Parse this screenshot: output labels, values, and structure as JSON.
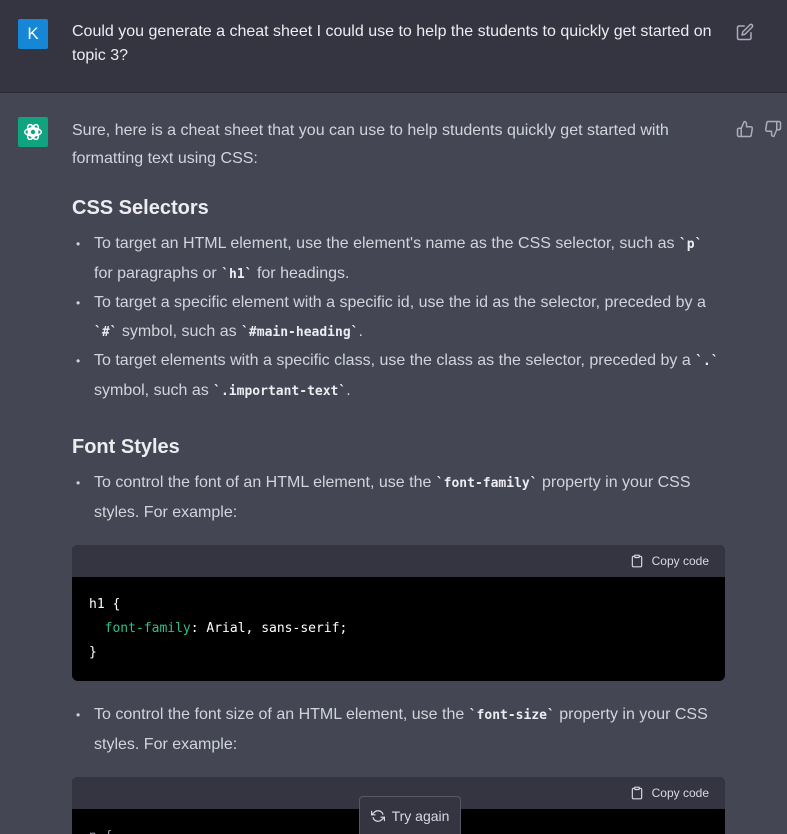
{
  "user": {
    "avatar_letter": "K",
    "message": "Could you generate a cheat sheet I could use to help the students to quickly get started on topic 3?"
  },
  "assistant": {
    "intro": "Sure, here is a cheat sheet that you can use to help students quickly get started with formatting text using CSS:",
    "section1": {
      "title": "CSS Selectors",
      "b1_a": "To target an HTML element, use the element's name as the CSS selector, such as ",
      "b1_c1": "`p`",
      "b1_b": " for paragraphs or ",
      "b1_c2": "`h1`",
      "b1_c": " for headings.",
      "b2_a": "To target a specific element with a specific id, use the id as the selector, preceded by a ",
      "b2_c1": "`#`",
      "b2_b": " symbol, such as ",
      "b2_c2": "`#main-heading`",
      "b2_c": ".",
      "b3_a": "To target elements with a specific class, use the class as the selector, preceded by a ",
      "b3_c1": "`.`",
      "b3_b": " symbol, such as ",
      "b3_c2": "`.important-text`",
      "b3_c": "."
    },
    "section2": {
      "title": "Font Styles",
      "b1_a": "To control the font of an HTML element, use the ",
      "b1_c1": "`font-family`",
      "b1_b": " property in your CSS styles. For example:",
      "b2_a": "To control the font size of an HTML element, use the ",
      "b2_c1": "`font-size`",
      "b2_b": " property in your CSS styles. For example:"
    },
    "code1": {
      "copy_label": "Copy code",
      "line1": "h1 {",
      "line2_prop": "font-family",
      "line2_rest": ": Arial, sans-serif;",
      "line3": "}"
    },
    "code2": {
      "copy_label": "Copy code",
      "line1": "p {"
    }
  },
  "try_again_label": "Try again",
  "colors": {
    "user_bg": "#343541",
    "assistant_bg": "#444654",
    "accent": "#10a37f",
    "user_avatar": "#1686d6",
    "code_keyword": "#2ebf8b"
  },
  "icons": [
    "edit-icon",
    "openai-logo-icon",
    "thumbs-up-icon",
    "thumbs-down-icon",
    "clipboard-icon",
    "refresh-icon"
  ]
}
